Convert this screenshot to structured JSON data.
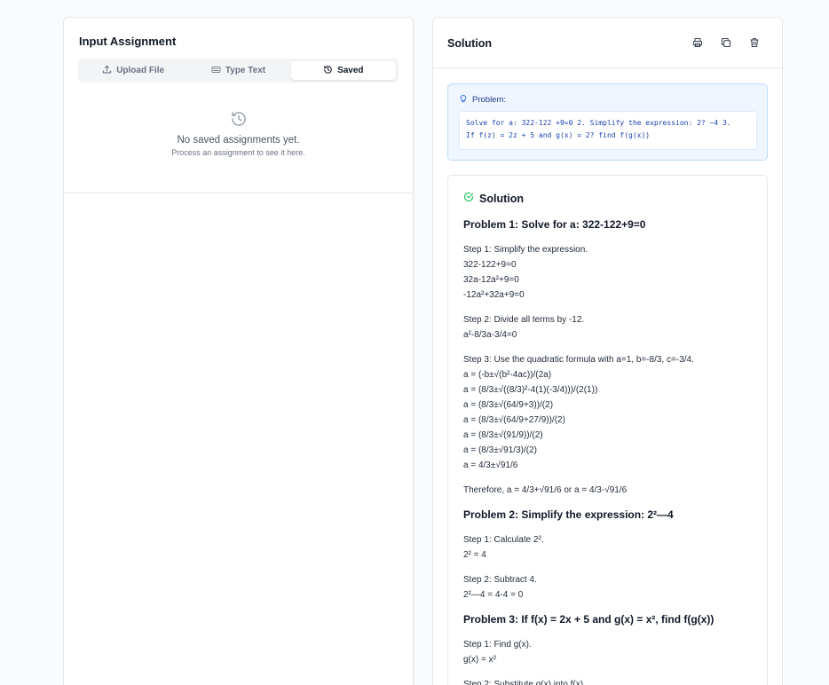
{
  "left": {
    "title": "Input Assignment",
    "tabs": [
      {
        "label": "Upload File",
        "icon": "upload-icon"
      },
      {
        "label": "Type Text",
        "icon": "keyboard-icon"
      },
      {
        "label": "Saved",
        "icon": "history-icon",
        "active": true
      }
    ],
    "empty_title": "No saved assignments yet.",
    "empty_subtitle": "Process an assignment to see it here."
  },
  "right": {
    "title": "Solution",
    "actions": [
      "print-icon",
      "copy-icon",
      "trash-icon"
    ],
    "problem_label": "Problem:",
    "problem_text_line1": "Solve for a: 322-122 +9=0 2. Simplify the expression: 2? −4 3.",
    "problem_text_line2": "If f(z) = 2z + 5 and g(x) = 2? find f(g(x))",
    "solution_heading": "Solution",
    "sections": [
      {
        "heading": "Problem 1: Solve for a: 322-122+9=0",
        "blocks": [
          [
            "Step 1: Simplify the expression.",
            "322-122+9=0",
            "32a-12a²+9=0",
            "-12a²+32a+9=0"
          ],
          [
            "Step 2: Divide all terms by -12.",
            "a²-8/3a-3/4=0"
          ],
          [
            "Step 3: Use the quadratic formula with a=1, b=-8/3, c=-3/4.",
            "a = (-b±√(b²-4ac))/(2a)",
            "a = (8/3±√((8/3)²-4(1)(-3/4)))/(2(1))",
            "a = (8/3±√(64/9+3))/(2)",
            "a = (8/3±√(64/9+27/9))/(2)",
            "a = (8/3±√(91/9))/(2)",
            "a = (8/3±√91/3)/(2)",
            "a = 4/3±√91/6"
          ],
          [
            "Therefore, a = 4/3+√91/6 or a = 4/3-√91/6"
          ]
        ]
      },
      {
        "heading": "Problem 2: Simplify the expression: 2²—4",
        "blocks": [
          [
            "Step 1: Calculate 2².",
            "2² = 4"
          ],
          [
            "Step 2: Subtract 4.",
            "2²—4 = 4-4 = 0"
          ]
        ]
      },
      {
        "heading": "Problem 3: If f(x) = 2x + 5 and g(x) = x², find f(g(x))",
        "blocks": [
          [
            "Step 1: Find g(x).",
            "g(x) = x²"
          ],
          [
            "Step 2: Substitute g(x) into f(x)."
          ]
        ]
      }
    ]
  }
}
